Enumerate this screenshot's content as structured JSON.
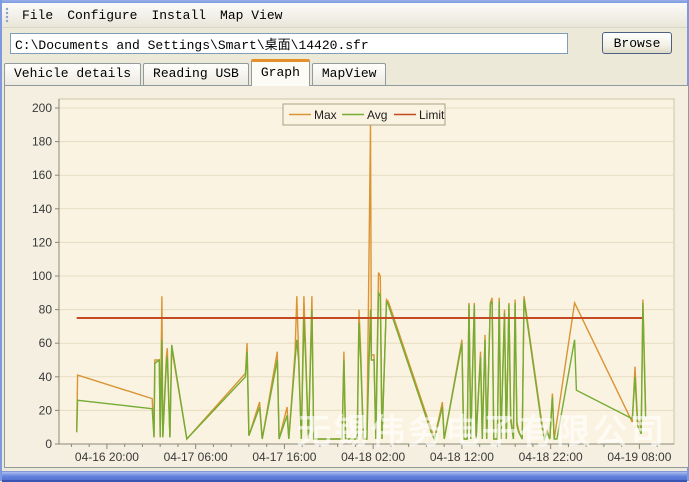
{
  "window": {
    "menu_items": [
      "File",
      "Configure",
      "Install",
      "Map View"
    ]
  },
  "toolbar": {
    "path_value": "C:\\Documents and Settings\\Smart\\桌面\\14420.sfr",
    "browse_label": "Browse"
  },
  "tabs": {
    "items": [
      {
        "label": "Vehicle details",
        "active": false
      },
      {
        "label": "Reading USB",
        "active": false
      },
      {
        "label": "Graph",
        "active": true
      },
      {
        "label": "MapView",
        "active": false
      }
    ]
  },
  "chart_data": {
    "type": "line",
    "title": "",
    "xlabel": "",
    "ylabel": "",
    "ylim": [
      0,
      200
    ],
    "ytick_step": 20,
    "y_tick_labels": [
      0,
      20,
      40,
      60,
      80,
      100,
      120,
      140,
      160,
      180,
      200
    ],
    "x_tick_labels": [
      "04-16 20:00",
      "04-17 06:00",
      "04-17 16:00",
      "04-18 02:00",
      "04-18 12:00",
      "04-18 22:00",
      "04-19 08:00"
    ],
    "x_label_hours": [
      0,
      10,
      20,
      30,
      40,
      50,
      60
    ],
    "x_range_hours": [
      -5.4,
      63.9
    ],
    "grid": true,
    "legend_position": "top-center",
    "plot_bg": "#FBF3E1",
    "grid_color": "#E5DCC2",
    "axis_color": "#8A8876",
    "watermark": "无锡伟务电子有限公司",
    "series": [
      {
        "name": "Max",
        "color": "#D99434",
        "width": 1.4,
        "points": [
          [
            -3.4,
            7
          ],
          [
            -3.3,
            41
          ],
          [
            5.1,
            27
          ],
          [
            5.3,
            4
          ],
          [
            5.4,
            50
          ],
          [
            5.9,
            50
          ],
          [
            6.0,
            4
          ],
          [
            6.2,
            88
          ],
          [
            6.3,
            4
          ],
          [
            6.7,
            52
          ],
          [
            6.8,
            57
          ],
          [
            7.1,
            4
          ],
          [
            7.3,
            57
          ],
          [
            9.0,
            3
          ],
          [
            15.6,
            42
          ],
          [
            15.8,
            60
          ],
          [
            16.0,
            5
          ],
          [
            17.2,
            25
          ],
          [
            17.5,
            3
          ],
          [
            19.2,
            55
          ],
          [
            19.4,
            3
          ],
          [
            20.3,
            22
          ],
          [
            20.5,
            3
          ],
          [
            21.2,
            55
          ],
          [
            21.4,
            88
          ],
          [
            21.6,
            55
          ],
          [
            21.9,
            3
          ],
          [
            22.2,
            88
          ],
          [
            22.4,
            55
          ],
          [
            22.7,
            3
          ],
          [
            23.1,
            88
          ],
          [
            23.3,
            3
          ],
          [
            26.5,
            3
          ],
          [
            26.7,
            55
          ],
          [
            26.9,
            3
          ],
          [
            28.2,
            3
          ],
          [
            28.4,
            80
          ],
          [
            28.6,
            55
          ],
          [
            28.9,
            3
          ],
          [
            29.3,
            3
          ],
          [
            29.7,
            190
          ],
          [
            29.8,
            53
          ],
          [
            30.1,
            53
          ],
          [
            30.3,
            3
          ],
          [
            30.6,
            102
          ],
          [
            30.8,
            100
          ],
          [
            31.0,
            3
          ],
          [
            31.5,
            86
          ],
          [
            31.7,
            85
          ],
          [
            33.3,
            60
          ],
          [
            36.6,
            8
          ],
          [
            36.9,
            3
          ],
          [
            37.8,
            25
          ],
          [
            38.0,
            3
          ],
          [
            40.0,
            62
          ],
          [
            40.2,
            3
          ],
          [
            40.6,
            3
          ],
          [
            40.8,
            84
          ],
          [
            41.0,
            3
          ],
          [
            41.4,
            84
          ],
          [
            41.6,
            3
          ],
          [
            42.1,
            55
          ],
          [
            42.3,
            3
          ],
          [
            42.6,
            65
          ],
          [
            42.8,
            3
          ],
          [
            43.2,
            84
          ],
          [
            43.4,
            87
          ],
          [
            43.6,
            3
          ],
          [
            44.0,
            3
          ],
          [
            44.2,
            87
          ],
          [
            44.4,
            3
          ],
          [
            44.8,
            80
          ],
          [
            45.0,
            3
          ],
          [
            45.3,
            84
          ],
          [
            45.5,
            16
          ],
          [
            45.8,
            3
          ],
          [
            46.0,
            86
          ],
          [
            46.2,
            13
          ],
          [
            46.4,
            8
          ],
          [
            46.8,
            3
          ],
          [
            47.0,
            88
          ],
          [
            49.0,
            13
          ],
          [
            49.3,
            3
          ],
          [
            49.6,
            8
          ],
          [
            49.9,
            3
          ],
          [
            50.2,
            30
          ],
          [
            50.4,
            3
          ],
          [
            52.7,
            84
          ],
          [
            59.2,
            13
          ],
          [
            59.5,
            46
          ],
          [
            59.8,
            13
          ],
          [
            60.0,
            13
          ],
          [
            60.2,
            8
          ],
          [
            60.4,
            86
          ],
          [
            60.7,
            20
          ]
        ]
      },
      {
        "name": "Avg",
        "color": "#74AC34",
        "width": 1.4,
        "points": [
          [
            -3.4,
            7
          ],
          [
            -3.3,
            26
          ],
          [
            5.1,
            21
          ],
          [
            5.3,
            4
          ],
          [
            5.4,
            48
          ],
          [
            5.9,
            50
          ],
          [
            6.0,
            4
          ],
          [
            6.2,
            62
          ],
          [
            6.3,
            4
          ],
          [
            6.7,
            48
          ],
          [
            6.8,
            52
          ],
          [
            7.1,
            4
          ],
          [
            7.3,
            59
          ],
          [
            9.0,
            3
          ],
          [
            15.6,
            40
          ],
          [
            15.8,
            55
          ],
          [
            16.0,
            5
          ],
          [
            17.2,
            22
          ],
          [
            17.5,
            3
          ],
          [
            19.2,
            50
          ],
          [
            19.4,
            3
          ],
          [
            20.3,
            17
          ],
          [
            20.5,
            3
          ],
          [
            21.2,
            50
          ],
          [
            21.4,
            62
          ],
          [
            21.6,
            50
          ],
          [
            21.9,
            3
          ],
          [
            22.2,
            75
          ],
          [
            22.4,
            50
          ],
          [
            22.7,
            3
          ],
          [
            23.1,
            80
          ],
          [
            23.3,
            3
          ],
          [
            26.5,
            3
          ],
          [
            26.7,
            50
          ],
          [
            26.9,
            3
          ],
          [
            28.2,
            3
          ],
          [
            28.4,
            72
          ],
          [
            28.6,
            50
          ],
          [
            28.9,
            3
          ],
          [
            29.3,
            3
          ],
          [
            29.7,
            80
          ],
          [
            29.8,
            50
          ],
          [
            30.1,
            50
          ],
          [
            30.3,
            3
          ],
          [
            30.6,
            90
          ],
          [
            30.8,
            88
          ],
          [
            31.0,
            3
          ],
          [
            31.5,
            85
          ],
          [
            31.7,
            83
          ],
          [
            33.3,
            58
          ],
          [
            36.6,
            6
          ],
          [
            36.9,
            3
          ],
          [
            37.8,
            22
          ],
          [
            38.0,
            3
          ],
          [
            40.0,
            60
          ],
          [
            40.2,
            3
          ],
          [
            40.6,
            3
          ],
          [
            40.8,
            83
          ],
          [
            41.0,
            3
          ],
          [
            41.4,
            83
          ],
          [
            41.6,
            3
          ],
          [
            42.1,
            52
          ],
          [
            42.3,
            3
          ],
          [
            42.6,
            62
          ],
          [
            42.8,
            3
          ],
          [
            43.2,
            83
          ],
          [
            43.4,
            85
          ],
          [
            43.6,
            3
          ],
          [
            44.0,
            3
          ],
          [
            44.2,
            85
          ],
          [
            44.4,
            3
          ],
          [
            44.8,
            78
          ],
          [
            45.0,
            3
          ],
          [
            45.3,
            83
          ],
          [
            45.5,
            14
          ],
          [
            45.8,
            3
          ],
          [
            46.0,
            84
          ],
          [
            46.2,
            11
          ],
          [
            46.4,
            7
          ],
          [
            46.8,
            3
          ],
          [
            47.0,
            86
          ],
          [
            49.0,
            11
          ],
          [
            49.3,
            3
          ],
          [
            49.6,
            7
          ],
          [
            49.9,
            3
          ],
          [
            50.2,
            28
          ],
          [
            50.4,
            3
          ],
          [
            50.7,
            3
          ],
          [
            52.7,
            62
          ],
          [
            52.9,
            32
          ],
          [
            59.2,
            15
          ],
          [
            59.5,
            40
          ],
          [
            59.8,
            11
          ],
          [
            60.2,
            6
          ],
          [
            60.4,
            84
          ],
          [
            60.7,
            16
          ]
        ]
      },
      {
        "name": "Limit",
        "color": "#C34A21",
        "width": 2,
        "points": [
          [
            -3.4,
            75
          ],
          [
            60.3,
            75
          ]
        ]
      }
    ]
  }
}
